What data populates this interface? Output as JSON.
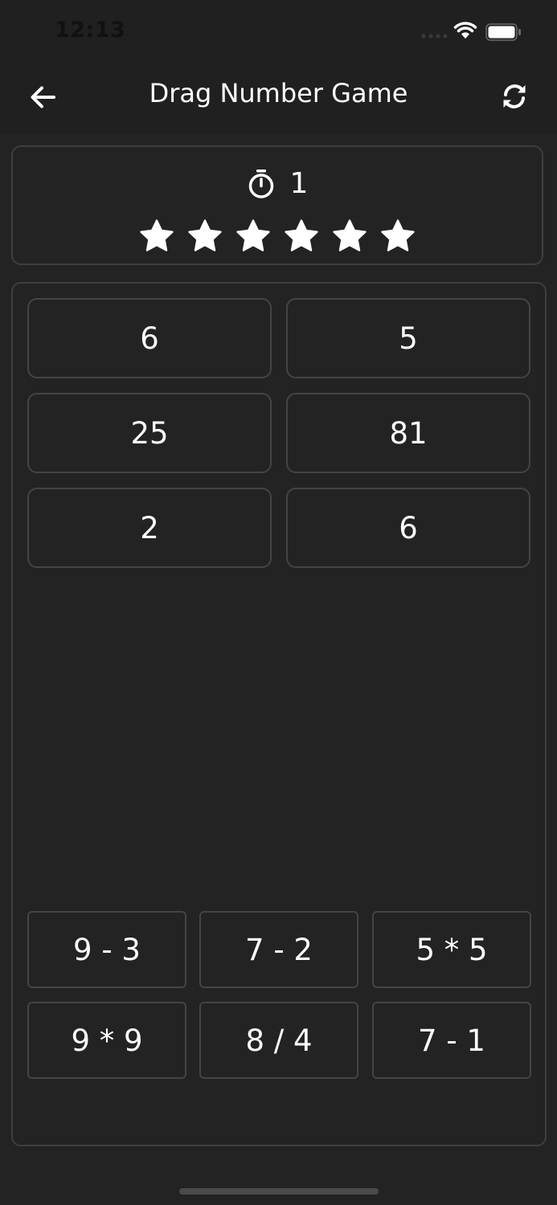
{
  "status_bar": {
    "time": "12:13",
    "icons": [
      "signal-icon",
      "wifi-icon",
      "battery-icon"
    ]
  },
  "app_bar": {
    "title": "Drag Number Game",
    "back_icon": "arrow-left-icon",
    "refresh_icon": "refresh-icon"
  },
  "score": {
    "timer_icon": "stopwatch-icon",
    "timer_value": "1",
    "stars_filled": 6,
    "stars_total": 6
  },
  "targets": [
    "6",
    "5",
    "25",
    "81",
    "2",
    "6"
  ],
  "expressions": [
    "9 - 3",
    "7 - 2",
    "5 * 5",
    "9 * 9",
    "8 / 4",
    "7 - 1"
  ],
  "colors": {
    "background": "#232323",
    "bar_background": "#202020",
    "border": "#444444",
    "text": "#ffffff"
  }
}
